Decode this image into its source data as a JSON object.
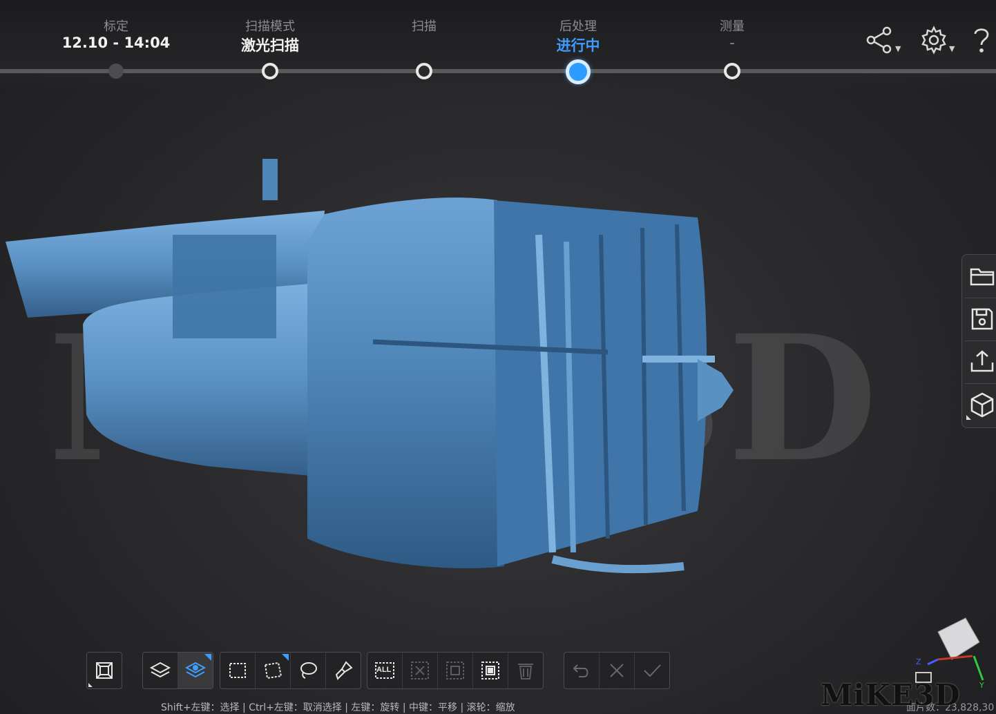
{
  "workflow": {
    "steps": [
      {
        "title": "标定",
        "value": "12.10 - 14:04",
        "state": "done"
      },
      {
        "title": "扫描模式",
        "value": "激光扫描",
        "state": "normal"
      },
      {
        "title": "扫描",
        "value": "",
        "state": "normal"
      },
      {
        "title": "后处理",
        "value": "进行中",
        "state": "active"
      },
      {
        "title": "测量",
        "value": "-",
        "state": "normal"
      }
    ]
  },
  "top_icons": [
    "share-icon",
    "settings-icon",
    "help-icon"
  ],
  "side_panel": [
    "folder-icon",
    "save-icon",
    "export-icon",
    "model-cube-icon"
  ],
  "toolbar": {
    "groups": [
      [
        "wireframe-box-icon"
      ],
      [
        "layers-icon",
        "layers-selected-icon"
      ],
      [
        "rect-select-icon",
        "polygon-select-icon",
        "lasso-select-icon",
        "brush-select-icon"
      ],
      [
        "select-all-icon",
        "deselect-icon",
        "invert-select-icon",
        "select-connected-icon",
        "delete-icon"
      ],
      [
        "undo-icon",
        "cancel-icon",
        "confirm-icon"
      ]
    ],
    "all_label": "ALL"
  },
  "status": {
    "hint": "Shift+左键：选择 | Ctrl+左键：取消选择 | 左键：旋转 | 中键：平移 | 滚轮：缩放",
    "count": "面片数：23,828,30"
  },
  "watermark": "MiKE3D",
  "logo": "MiKE3D",
  "colors": {
    "accent": "#2d9bff",
    "model": "#4f86b8",
    "background": "#2b2b2d"
  }
}
